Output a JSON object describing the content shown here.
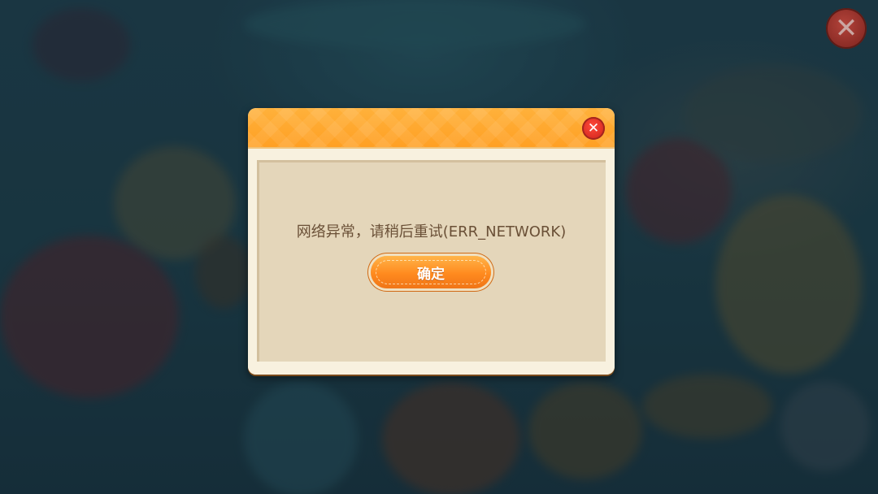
{
  "dialog": {
    "message": "网络异常，请稍后重试(ERR_NETWORK)",
    "confirm_label": "确定",
    "close_icon": "close-icon"
  },
  "top_close": {
    "icon": "close-icon"
  },
  "colors": {
    "header_orange": "#ffa024",
    "panel_beige": "#e4d6ba",
    "message_text": "#6a5037",
    "button_orange": "#ff8a1e",
    "close_red": "#d92b22"
  }
}
